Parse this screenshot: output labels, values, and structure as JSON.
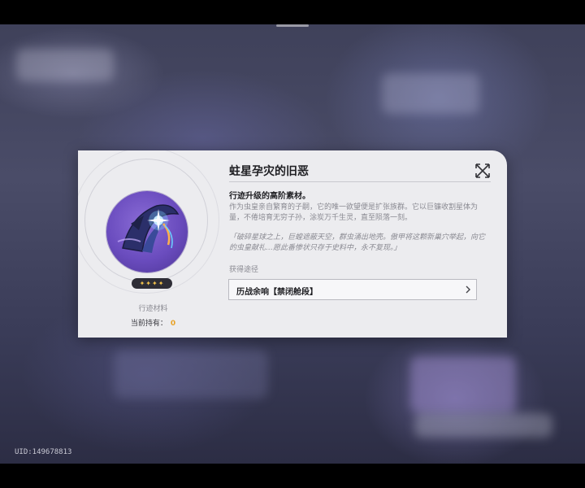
{
  "background": {
    "uid": "UID:149678813"
  },
  "dialog": {
    "title": "蛀星孕灾的旧恶",
    "subtitle": "行迹升级的高阶素材。",
    "description": "作为虫皇亲自繁育的子嗣，它的唯一欲望便是扩张族群。它以巨镰收割星体为量，不倦培育无穷子孙，涂炭万千生灵，直至陨落一刻。",
    "lore": "「破碎星球之上，巨蝗遮蔽天空，群虫涌出地壳。傲甲将这颗新巢穴举起，向它的虫皇献礼…愿此番惨状只存于史料中，永不复现。」",
    "source_label": "获得途径",
    "source_button": "历战余响【禁闭舱段】",
    "item": {
      "rarity_stars": "✦✦✦✦",
      "type": "行迹材料",
      "holding_label": "当前持有：",
      "holding_count": "0"
    },
    "icons": {
      "close": "close-icon",
      "chevron": "chevron-right-icon",
      "item": "scythe-material-icon"
    },
    "colors": {
      "accent_count": "#e8a227",
      "rarity_gold": "#f3c24c",
      "item_bg": "#6a4cbe"
    }
  }
}
